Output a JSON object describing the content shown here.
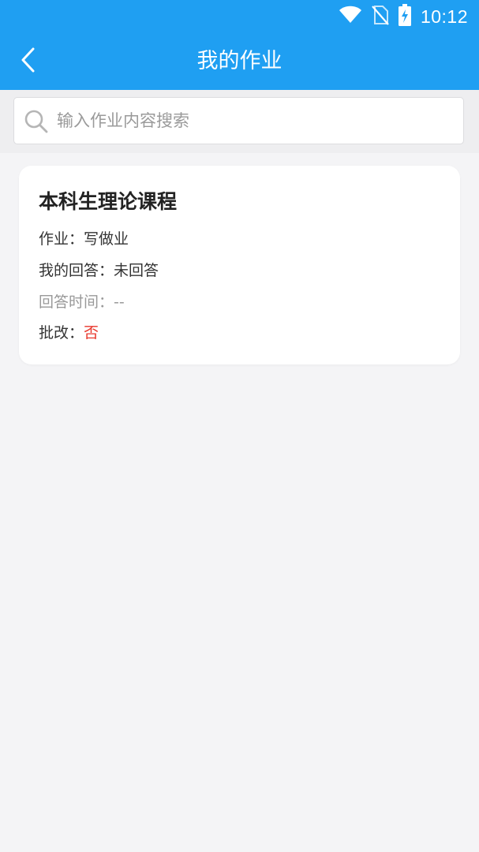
{
  "status_bar": {
    "time": "10:12",
    "icons": [
      "wifi-icon",
      "no-sim-icon",
      "battery-charging-icon"
    ]
  },
  "nav": {
    "back_icon": "chevron-left-icon",
    "title": "我的作业"
  },
  "search": {
    "placeholder": "输入作业内容搜索",
    "value": "",
    "icon": "search-icon"
  },
  "homework": [
    {
      "course": "本科生理论课程",
      "assignment_label": "作业：",
      "assignment_value": "写做业",
      "answer_label": "我的回答：",
      "answer_value": "未回答",
      "answer_time_label": "回答时间：",
      "answer_time_value": "--",
      "graded_label": "批改：",
      "graded_value": "否"
    }
  ],
  "colors": {
    "header": "#1f9ff2",
    "background": "#f4f4f6",
    "graded_no": "#e8372c"
  }
}
